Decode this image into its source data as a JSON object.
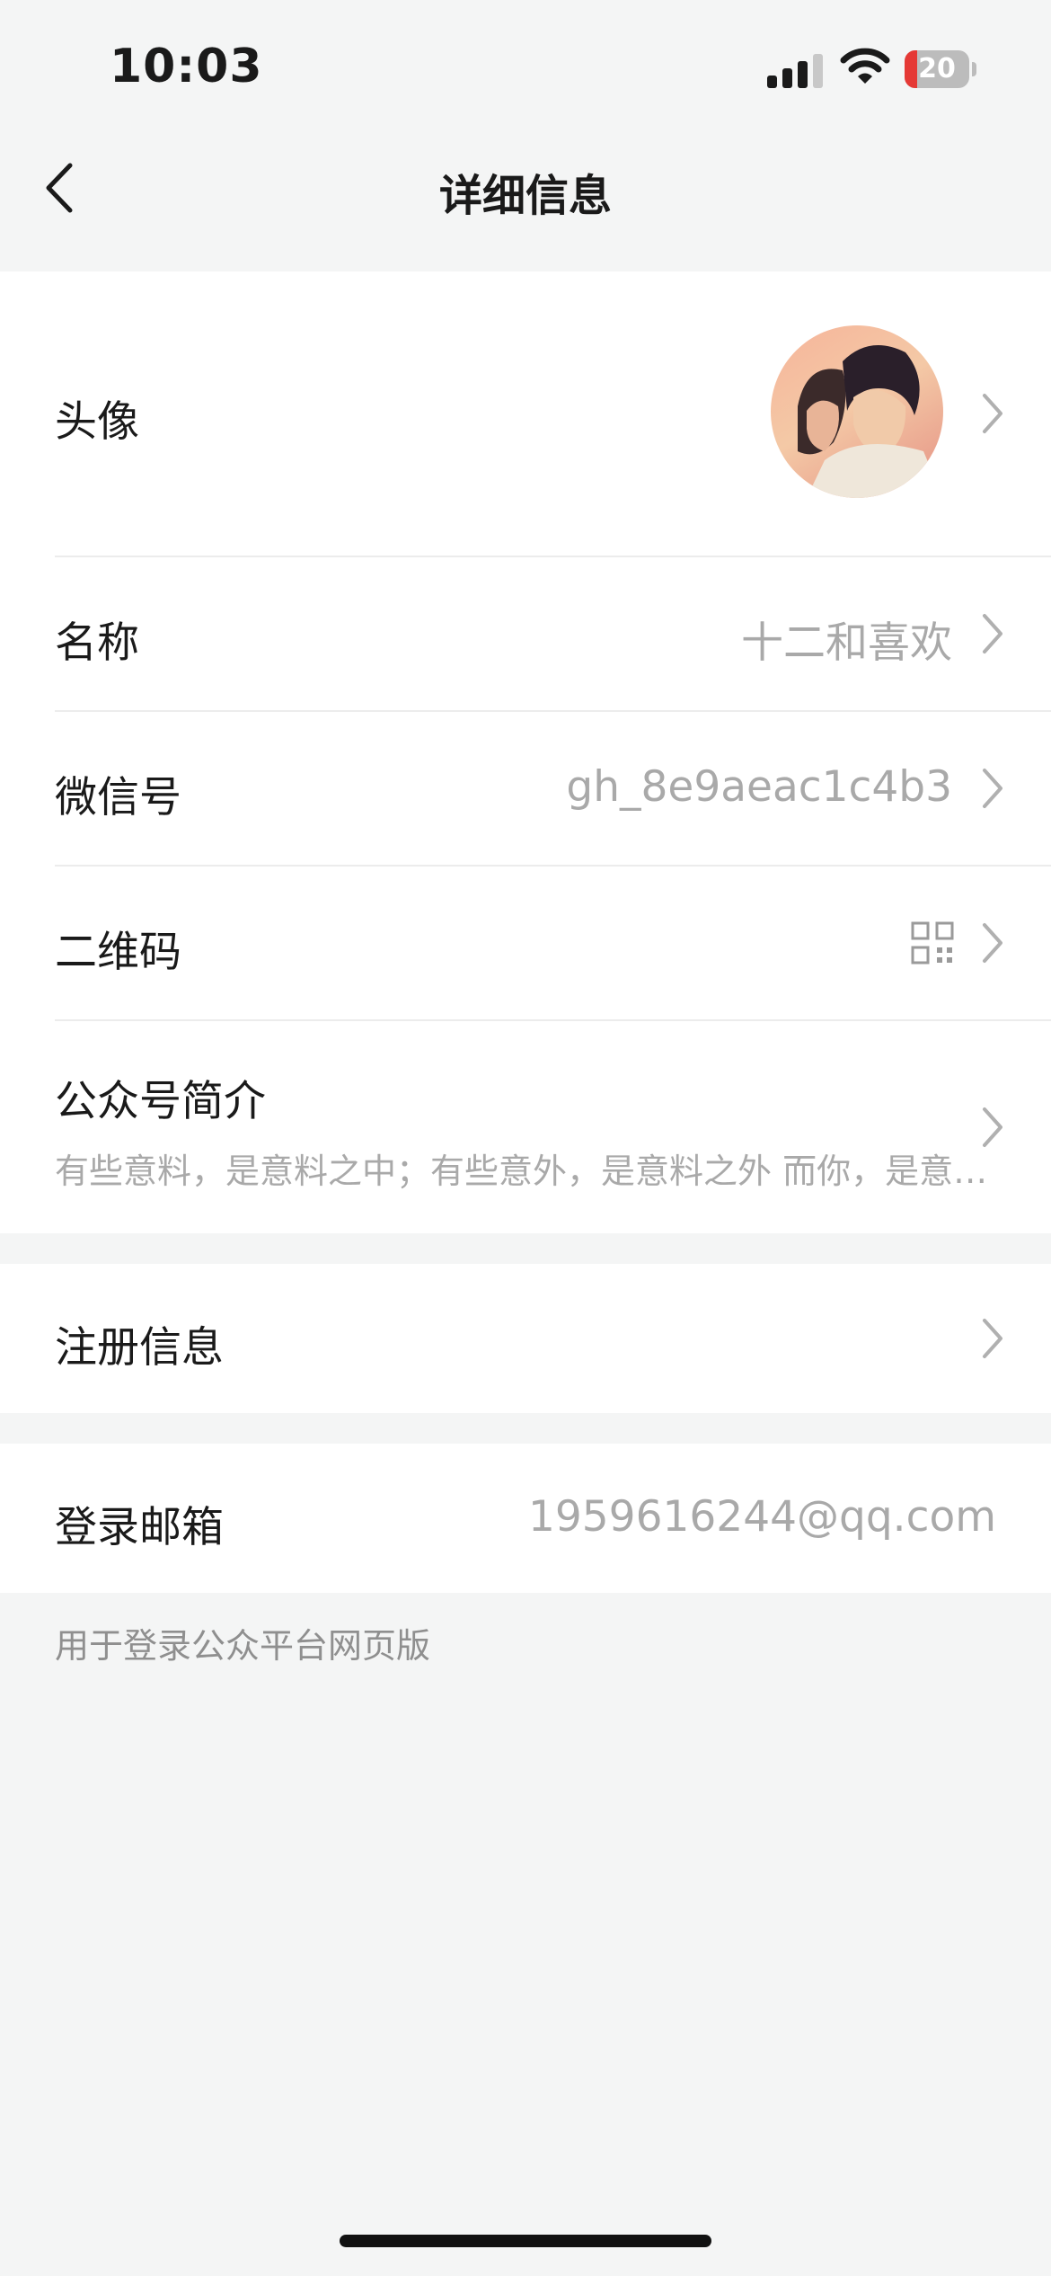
{
  "status": {
    "time": "10:03",
    "battery": "20"
  },
  "nav": {
    "title": "详细信息"
  },
  "rows": {
    "avatar": {
      "label": "头像"
    },
    "name": {
      "label": "名称",
      "value": "十二和喜欢"
    },
    "wechat_id": {
      "label": "微信号",
      "value": "gh_8e9aeac1c4b3"
    },
    "qrcode": {
      "label": "二维码"
    },
    "intro": {
      "label": "公众号简介",
      "value": "有些意料，是意料之中；有些意外，是意料之外 而你，是意料之外的惊喜"
    },
    "register": {
      "label": "注册信息"
    },
    "email": {
      "label": "登录邮箱",
      "value": "1959616244@qq.com"
    }
  },
  "footnote": "用于登录公众平台网页版",
  "colors": {
    "background": "#f4f5f5",
    "card": "#ffffff",
    "secondary_text": "#a9a9a9"
  }
}
